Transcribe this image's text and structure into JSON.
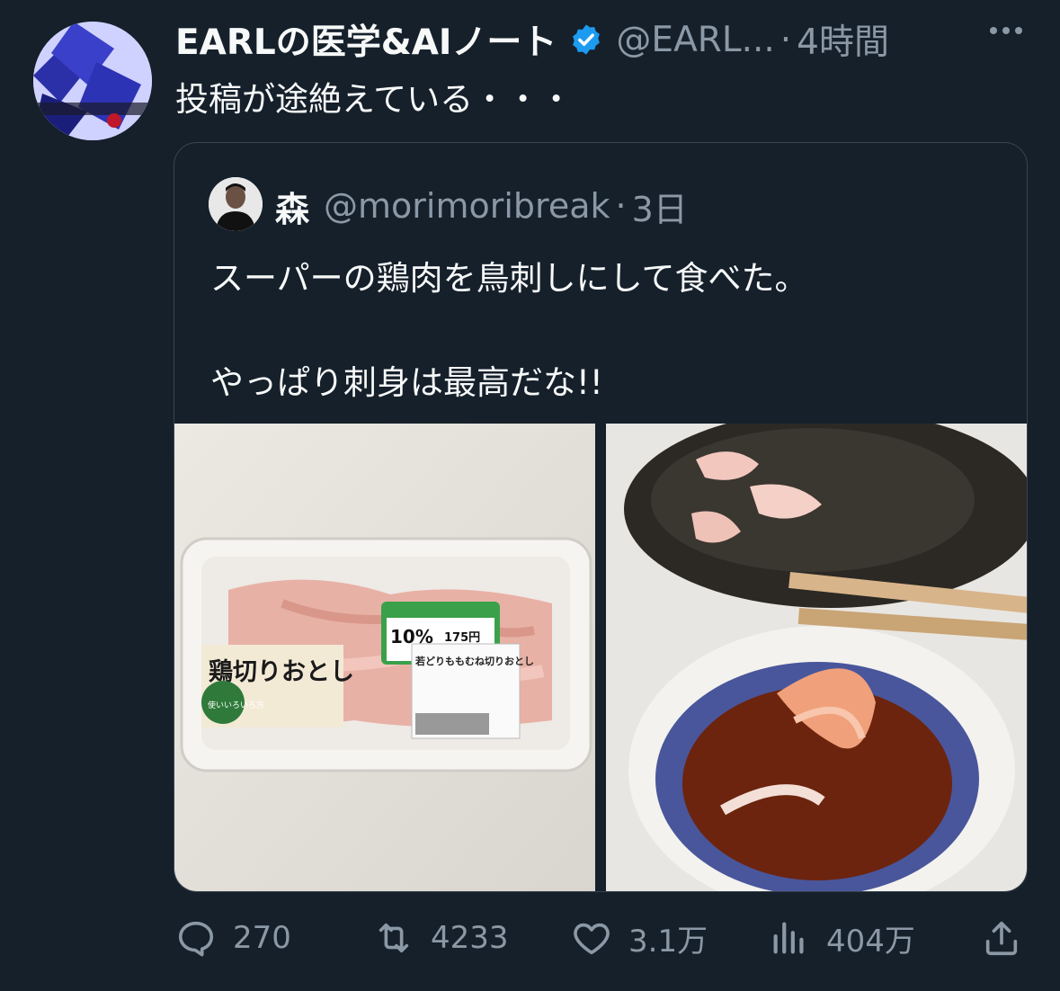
{
  "author": {
    "name": "EARLの医学&AIノート",
    "handle": "@EARL...",
    "dot": "·",
    "time": "4時間",
    "verified": true
  },
  "tweet": {
    "text": "投稿が途絶えている・・・"
  },
  "quoted": {
    "name": "森",
    "handle": "@morimoribreak",
    "dot": "·",
    "time": "3日",
    "text": "スーパーの鶏肉を鳥刺しにして食べた。\n\nやっぱり刺身は最高だな!!",
    "photo1": {
      "package_label": "鶏切りおとし",
      "price_tag": "10%",
      "price": "175円",
      "sticker_text": "若どりももむね切りおとし",
      "badge_text": "使いいろいろ方"
    }
  },
  "actions": {
    "replies": "270",
    "retweets": "4233",
    "likes": "3.1万",
    "views": "404万"
  },
  "colors": {
    "background": "#15202b",
    "text": "#f7f9f9",
    "muted": "#8b98a5",
    "verified": "#1d9bf0",
    "border": "#38444d"
  }
}
